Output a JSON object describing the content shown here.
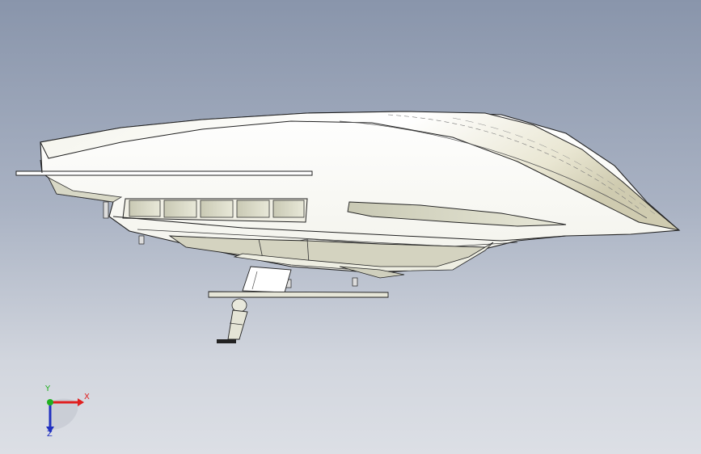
{
  "viewport": {
    "background_top": "#8995ab",
    "background_bottom": "#dcdfe5",
    "model": "yacht-hull-side-view"
  },
  "triad": {
    "x_label": "X",
    "y_label": "Y",
    "z_label": "Z",
    "x_color": "#e02020",
    "y_color": "#20b020",
    "z_color": "#2030c0"
  }
}
